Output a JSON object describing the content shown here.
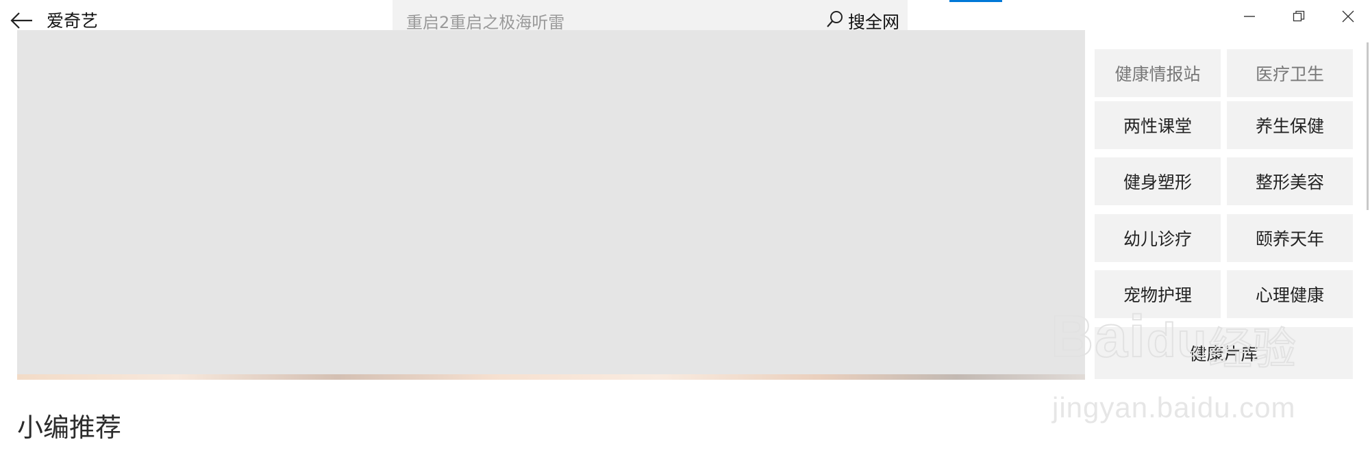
{
  "app": {
    "title": "爱奇艺"
  },
  "search": {
    "placeholder": "重启2重启之极海听雷",
    "search_all_label": "搜全网"
  },
  "window_controls": [
    "minimize-icon",
    "restore-icon",
    "close-icon"
  ],
  "categories": [
    {
      "label": "健康情报站"
    },
    {
      "label": "医疗卫生"
    },
    {
      "label": "两性课堂"
    },
    {
      "label": "养生保健"
    },
    {
      "label": "健身塑形"
    },
    {
      "label": "整形美容"
    },
    {
      "label": "幼儿诊疗"
    },
    {
      "label": "颐养天年"
    },
    {
      "label": "宠物护理"
    },
    {
      "label": "心理健康"
    },
    {
      "label": "健康片库"
    }
  ],
  "section": {
    "title": "小编推荐"
  },
  "watermark": {
    "logo_text": "Baidu经验",
    "url": "jingyan.baidu.com"
  },
  "colors": {
    "accent": "#0078d7",
    "tile_bg": "#f2f2f2",
    "banner_bg": "#e5e5e5"
  }
}
